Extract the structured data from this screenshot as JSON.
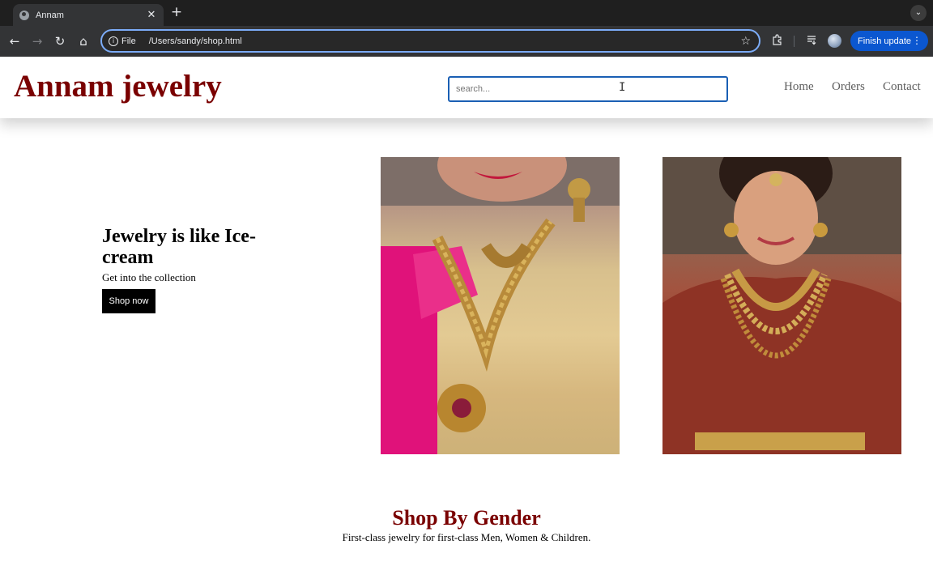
{
  "browser": {
    "tab_title": "Annam",
    "tab_close": "✕",
    "new_tab": "+",
    "tab_menu": "⌄",
    "nav": {
      "back": "←",
      "forward": "→",
      "reload": "↻",
      "home": "⌂"
    },
    "address": {
      "scheme": "File",
      "url": "/Users/sandy/shop.html",
      "star": "☆"
    },
    "update_button": "Finish update",
    "menu_dots": "⋮"
  },
  "site": {
    "brand": "Annam jewelry",
    "search_placeholder": "search...",
    "nav": [
      "Home",
      "Orders",
      "Contact"
    ]
  },
  "hero": {
    "title": "Jewelry is like Ice-cream",
    "subtitle": "Get into the collection",
    "cta": "Shop now"
  },
  "section": {
    "title": "Shop By Gender",
    "subtitle": "First-class jewelry for first-class Men, Women & Children."
  },
  "colors": {
    "brand": "#7a0000",
    "search_border": "#1a5fb4",
    "update_button": "#0b57d0"
  }
}
